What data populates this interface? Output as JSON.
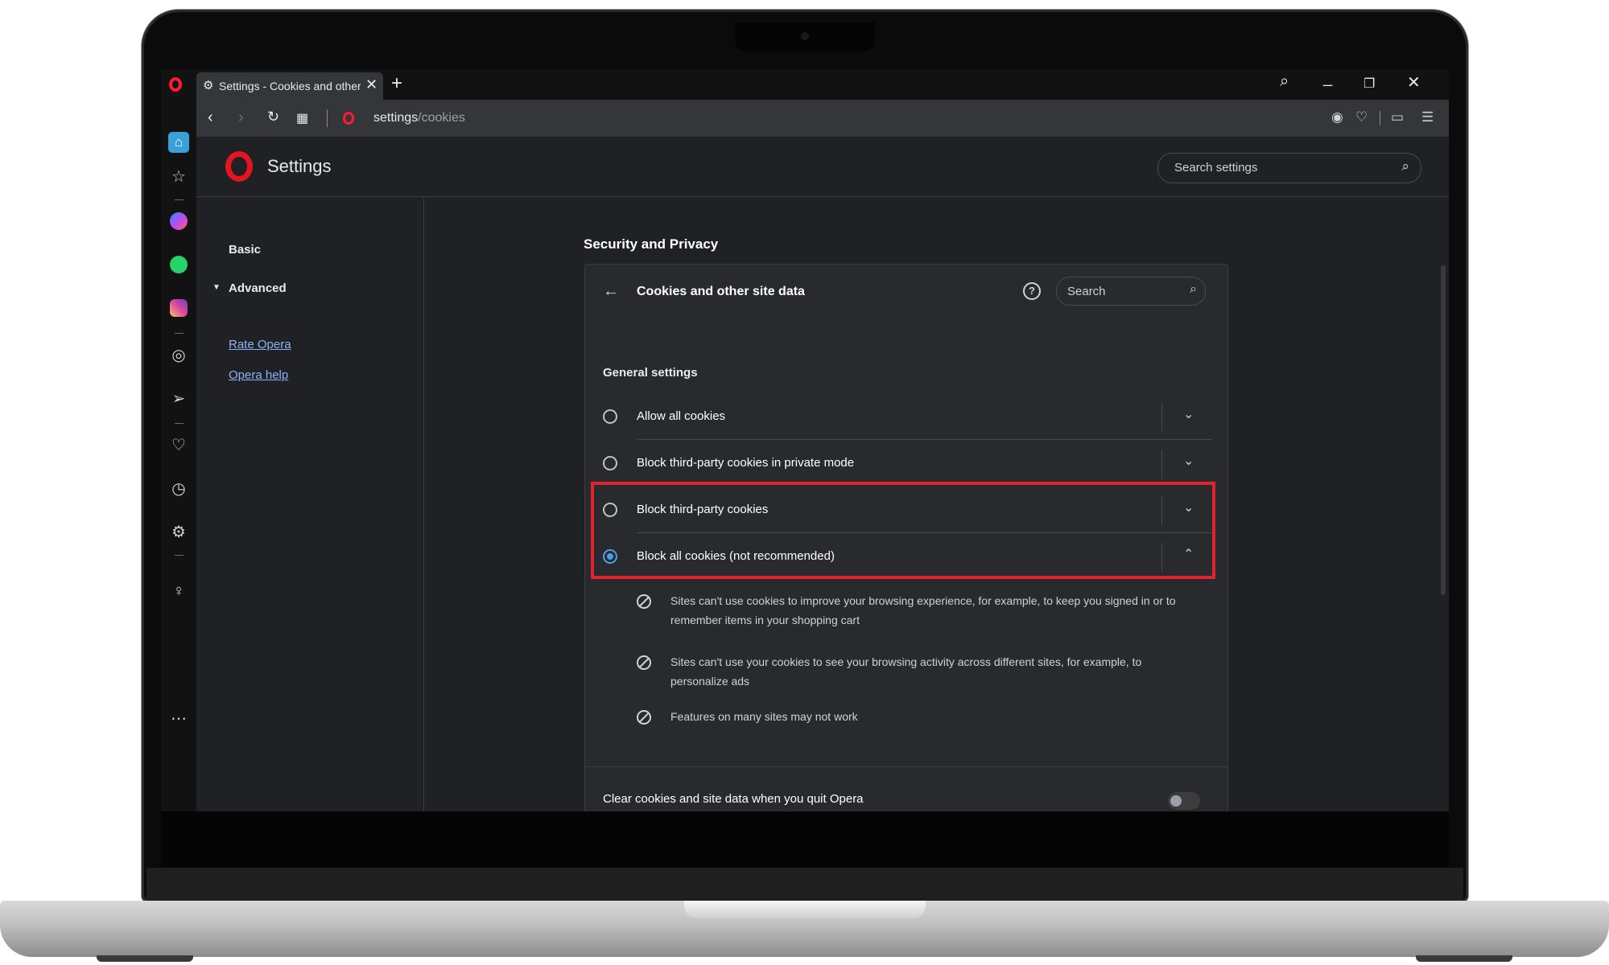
{
  "tab": {
    "title": "Settings - Cookies and other site data",
    "new_tab": "+",
    "close": "✕"
  },
  "window": {
    "search": "⌕",
    "minimize": "_",
    "restore": "❐",
    "close": "✕"
  },
  "address": {
    "host": "settings",
    "path": "/cookies"
  },
  "header": {
    "title": "Settings",
    "search_placeholder": "Search settings"
  },
  "leftnav": {
    "basic": "Basic",
    "advanced": "Advanced",
    "links": [
      "Rate Opera",
      "Opera help"
    ]
  },
  "section_title": "Security and Privacy",
  "card": {
    "title": "Cookies and other site data",
    "search_placeholder": "Search",
    "general": "General settings",
    "options": [
      {
        "label": "Allow all cookies",
        "selected": false,
        "expanded": false
      },
      {
        "label": "Block third-party cookies in private mode",
        "selected": false,
        "expanded": false
      },
      {
        "label": "Block third-party cookies",
        "selected": false,
        "expanded": false
      },
      {
        "label": "Block all cookies (not recommended)",
        "selected": true,
        "expanded": true
      }
    ],
    "details": [
      "Sites can't use cookies to improve your browsing experience, for example, to keep you signed in or to remember items in your shopping cart",
      "Sites can't use your cookies to see your browsing activity across different sites, for example, to personalize ads",
      "Features on many sites may not work"
    ],
    "clear_label": "Clear cookies and site data when you quit Opera",
    "clear_enabled": false
  },
  "highlight_color": "#e3222d",
  "accent_color": "#4c9ee8",
  "sidebar_icons": [
    "home-icon",
    "star-icon",
    "messenger-icon",
    "whatsapp-icon",
    "instagram-icon",
    "player-icon",
    "send-icon",
    "heart-icon",
    "history-icon",
    "gear-icon",
    "lightbulb-icon",
    "more-icon"
  ]
}
